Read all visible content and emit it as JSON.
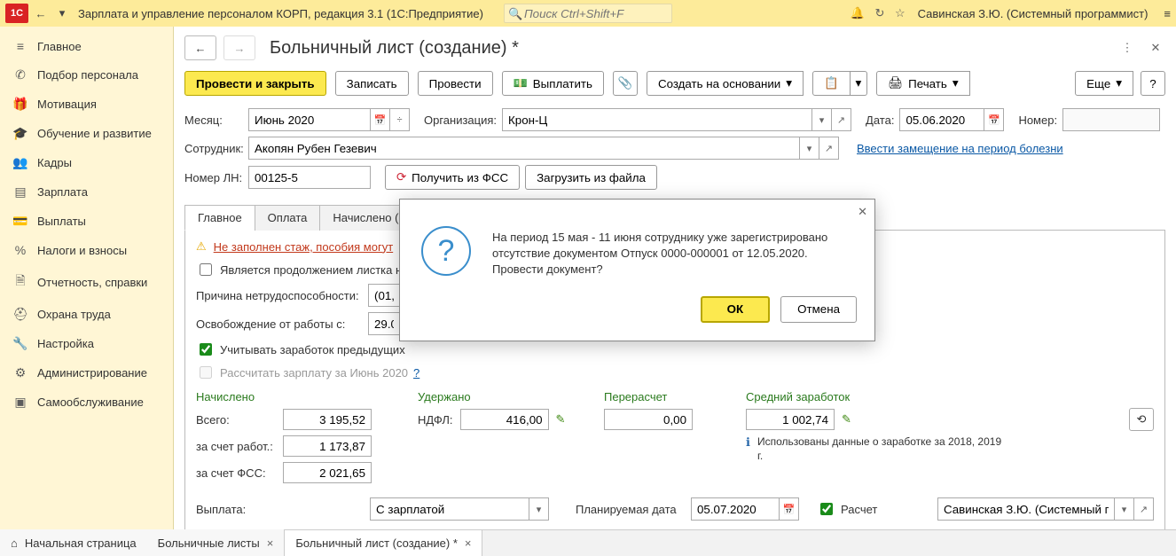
{
  "titlebar": {
    "logo": "1С",
    "app_title": "Зарплата и управление персоналом КОРП, редакция 3.1  (1С:Предприятие)",
    "search_placeholder": "Поиск Ctrl+Shift+F",
    "user": "Савинская З.Ю. (Системный программист)"
  },
  "sidebar": {
    "items": [
      {
        "icon": "≡",
        "label": "Главное"
      },
      {
        "icon": "✆",
        "label": "Подбор персонала"
      },
      {
        "icon": "🎁",
        "label": "Мотивация"
      },
      {
        "icon": "🎓",
        "label": "Обучение и развитие"
      },
      {
        "icon": "👥",
        "label": "Кадры"
      },
      {
        "icon": "▤",
        "label": "Зарплата"
      },
      {
        "icon": "💳",
        "label": "Выплаты"
      },
      {
        "icon": "%",
        "label": "Налоги и взносы"
      },
      {
        "icon": "🗎",
        "label": "Отчетность, справки"
      },
      {
        "icon": "⛑",
        "label": "Охрана труда"
      },
      {
        "icon": "🔧",
        "label": "Настройка"
      },
      {
        "icon": "⚙",
        "label": "Администрирование"
      },
      {
        "icon": "▣",
        "label": "Самообслуживание"
      }
    ]
  },
  "doc": {
    "title": "Больничный лист (создание) *",
    "toolbar": {
      "post_close": "Провести и закрыть",
      "save": "Записать",
      "post": "Провести",
      "pay": "Выплатить",
      "create_based": "Создать на основании",
      "print": "Печать",
      "more": "Еще"
    },
    "fields": {
      "month_lbl": "Месяц:",
      "month": "Июнь 2020",
      "org_lbl": "Организация:",
      "org": "Крон-Ц",
      "date_lbl": "Дата:",
      "date": "05.06.2020",
      "num_lbl": "Номер:",
      "num": "",
      "emp_lbl": "Сотрудник:",
      "emp": "Акопян Рубен Гезевич",
      "substitute_link": "Ввести замещение на период болезни",
      "ln_lbl": "Номер ЛН:",
      "ln": "00125-5",
      "get_fss": "Получить из ФСС",
      "load_file": "Загрузить из файла"
    },
    "tabs": [
      "Главное",
      "Оплата",
      "Начислено (п"
    ],
    "tab_main": {
      "warn_link": "Не заполнен стаж, пособия могут",
      "cont_chk": "Является продолжением листка н",
      "reason_lbl": "Причина нетрудоспособности:",
      "reason": "(01, 0",
      "absence_lbl": "Освобождение от работы с:",
      "absence": "29.05",
      "prev_chk": "Учитывать заработок предыдущих",
      "calc_chk": "Рассчитать зарплату за Июнь 2020"
    },
    "totals": {
      "accrued_hdr": "Начислено",
      "held_hdr": "Удержано",
      "recalc_hdr": "Перерасчет",
      "avg_hdr": "Средний заработок",
      "total_lbl": "Всего:",
      "total": "3 195,52",
      "ndfl_lbl": "НДФЛ:",
      "ndfl": "416,00",
      "recalc": "0,00",
      "avg": "1 002,74",
      "emp_lbl": "за счет работ.:",
      "emp": "1 173,87",
      "fss_lbl": "за счет ФСС:",
      "fss": "2 021,65",
      "info": "Использованы данные о заработке за 2018,  2019 г."
    },
    "bottom": {
      "pay_lbl": "Выплата:",
      "pay_val": "С зарплатой",
      "plan_lbl": "Планируемая дата",
      "plan_date": "05.07.2020",
      "calc_chk": "Расчет",
      "resp": "Савинская З.Ю. (Системный пр"
    }
  },
  "footer": {
    "home": "Начальная страница",
    "tab1": "Больничные листы",
    "tab2": "Больничный лист (создание) *"
  },
  "modal": {
    "text": "На период 15 мая - 11 июня сотруднику уже зарегистрировано отсутствие документом Отпуск 0000-000001 от 12.05.2020. Провести документ?",
    "ok": "ОК",
    "cancel": "Отмена"
  }
}
